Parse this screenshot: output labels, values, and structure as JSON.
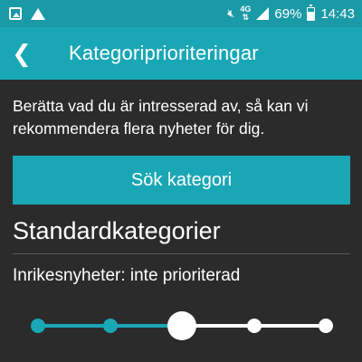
{
  "status_bar": {
    "network_label": "4G",
    "battery_text": "69%",
    "time": "14:43",
    "icons": [
      "gallery-icon",
      "drive-icon",
      "mute-icon",
      "signal-icon",
      "battery-icon"
    ]
  },
  "app_bar": {
    "back_glyph": "❮",
    "title": "Kategoriprioriteringar"
  },
  "description": "Berätta vad du är intresserad av, så kan vi rekommendera flera nyheter för dig.",
  "search_button_label": "Sök kategori",
  "section_heading": "Standardkategorier",
  "category": {
    "label": "Inrikesnyheter: inte prioriterad",
    "slider_steps": 5,
    "slider_value_index": 2
  },
  "colors": {
    "accent": "#1aa7b5",
    "background": "#2b2b2b",
    "text": "#ffffff"
  }
}
